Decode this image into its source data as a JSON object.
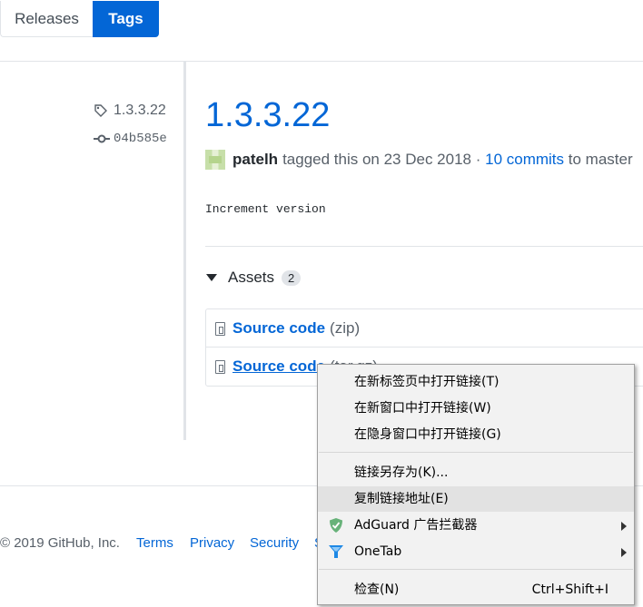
{
  "tabs": {
    "releases": "Releases",
    "tags": "Tags"
  },
  "sidebar": {
    "tag": "1.3.3.22",
    "commit": "04b585e"
  },
  "release": {
    "title": "1.3.3.22",
    "author": "patelh",
    "tagged_text": "tagged this on 23 Dec 2018 ·",
    "commits_link": "10 commits",
    "to_text": "to master",
    "body": "Increment version"
  },
  "assets": {
    "label": "Assets",
    "count": "2",
    "items": [
      {
        "name": "Source code",
        "ext": "(zip)"
      },
      {
        "name": "Source code",
        "ext": "(tar.gz)"
      }
    ]
  },
  "footer": {
    "copyright": "© 2019 GitHub, Inc.",
    "links": [
      "Terms",
      "Privacy",
      "Security",
      "S"
    ]
  },
  "context_menu": {
    "items": [
      {
        "label": "在新标签页中打开链接(T)"
      },
      {
        "label": "在新窗口中打开链接(W)"
      },
      {
        "label": "在隐身窗口中打开链接(G)"
      },
      {
        "label": "链接另存为(K)..."
      },
      {
        "label": "复制链接地址(E)"
      },
      {
        "label": "AdGuard 广告拦截器"
      },
      {
        "label": "OneTab"
      },
      {
        "label": "检查(N)",
        "shortcut": "Ctrl+Shift+I"
      }
    ]
  },
  "colors": {
    "link": "#0366d6",
    "accent": "#0366d6",
    "border": "#e1e4e8"
  }
}
